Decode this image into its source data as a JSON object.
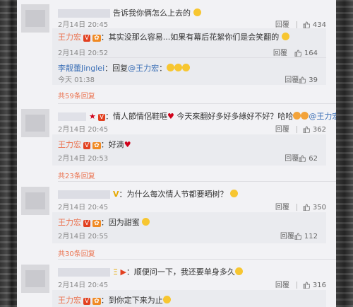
{
  "ui": {
    "reply_label": "回覆",
    "vip_badge": "V",
    "sub_badge": "✿"
  },
  "comments": [
    {
      "text": "告诉我你俩怎么上去的",
      "time": "2月14日 20:45",
      "likes": "434",
      "replies": [
        {
          "user": "王力宏",
          "text": "其实没那么容易...如果有幕后花絮你们是会笑翻的",
          "time": "2月14日 20:52",
          "likes": "164"
        },
        {
          "user": "李靓蕾Jinglei",
          "prefix": "回复",
          "mention": "@王力宏",
          "time": "今天 01:38",
          "likes": "39"
        }
      ],
      "more": "共59条回复"
    },
    {
      "text": "情人節情侶鞋嘔",
      "text2": "今天來翻好多好多綠好不好？哈哈",
      "mention": "@王力宏",
      "time": "2月14日 20:45",
      "likes": "362",
      "replies": [
        {
          "user": "王力宏",
          "text": "好滴",
          "time": "2月14日 20:53",
          "likes": "62"
        }
      ],
      "more": "共23条回复"
    },
    {
      "text": "为什么每次情人节都要晒树？",
      "time": "2月14日 20:45",
      "likes": "350",
      "replies": [
        {
          "user": "王力宏",
          "text": "因为甜蜜",
          "time": "2月14日 20:55",
          "likes": "112"
        }
      ],
      "more": "共30条回复"
    },
    {
      "text": "顺便问一下，我还要单身多久",
      "time": "2月14日 20:45",
      "likes": "316",
      "replies": [
        {
          "user": "王力宏",
          "text": "到你定下来为止"
        }
      ]
    }
  ]
}
